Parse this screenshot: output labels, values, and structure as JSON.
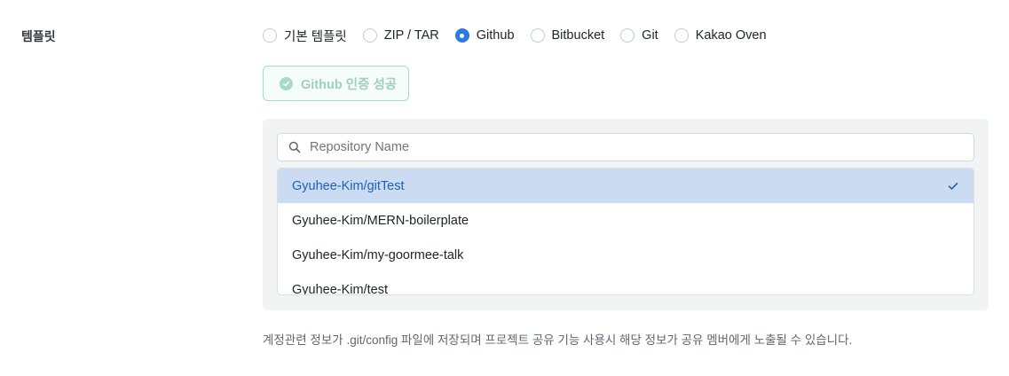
{
  "field": {
    "label": "템플릿"
  },
  "template_options": [
    {
      "label": "기본 템플릿",
      "checked": false
    },
    {
      "label": "ZIP / TAR",
      "checked": false
    },
    {
      "label": "Github",
      "checked": true
    },
    {
      "label": "Bitbucket",
      "checked": false
    },
    {
      "label": "Git",
      "checked": false
    },
    {
      "label": "Kakao Oven",
      "checked": false
    }
  ],
  "auth": {
    "label": "Github 인증 성공",
    "icon": "check-circle-icon"
  },
  "search": {
    "placeholder": "Repository Name",
    "value": ""
  },
  "repos": [
    {
      "name": "Gyuhee-Kim/gitTest",
      "selected": true
    },
    {
      "name": "Gyuhee-Kim/MERN-boilerplate",
      "selected": false
    },
    {
      "name": "Gyuhee-Kim/my-goormee-talk",
      "selected": false
    },
    {
      "name": "Gyuhee-Kim/test",
      "selected": false
    }
  ],
  "help_text": "계정관련 정보가 .git/config 파일에 저장되며 프로젝트 공유 기능 사용시 해당 정보가 공유 멤버에게 노출될 수 있습니다.",
  "colors": {
    "accent": "#2b7be0",
    "selected_bg": "#cbdcf2",
    "success": "#a6ddce"
  }
}
